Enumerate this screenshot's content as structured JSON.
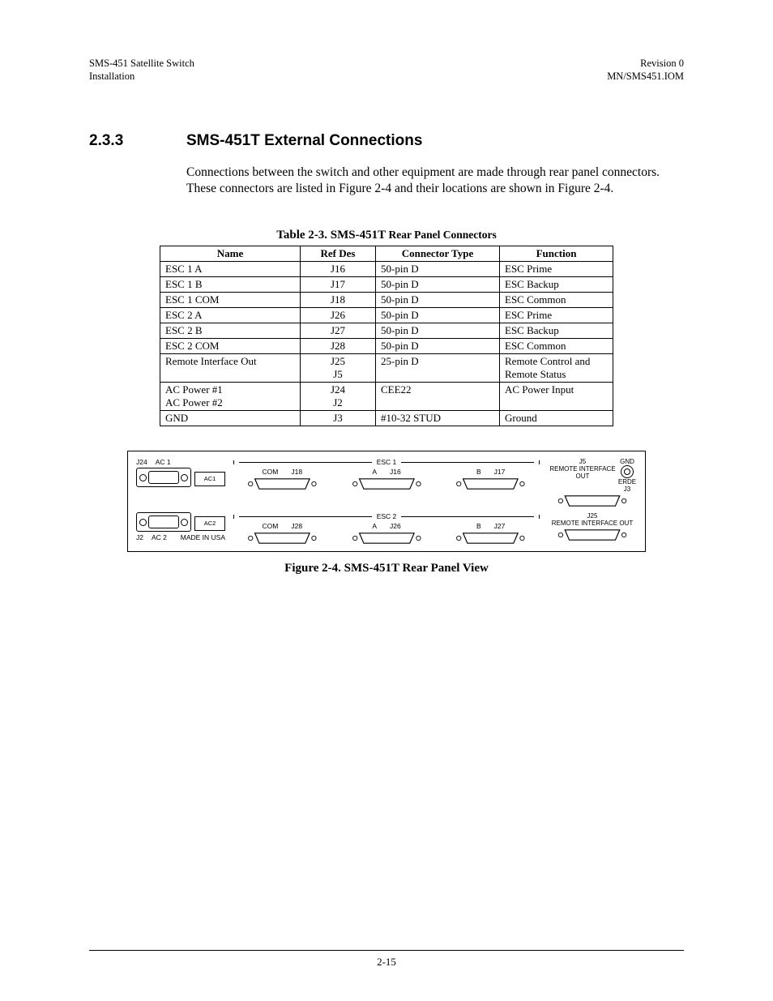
{
  "header": {
    "left_line1": "SMS-451 Satellite Switch",
    "left_line2": "Installation",
    "right_line1": "Revision 0",
    "right_line2": "MN/SMS451.IOM"
  },
  "section": {
    "number": "2.3.3",
    "title": "SMS-451T External Connections"
  },
  "paragraph": "Connections between the switch and other equipment are made through rear panel connectors. These connectors are listed in Figure 2-4 and their locations are shown in Figure 2-4.",
  "table": {
    "caption_prefix": "Table 2-3.  SMS-451T",
    "caption_suffix": " Rear Panel Connectors",
    "headers": [
      "Name",
      "Ref Des",
      "Connector Type",
      "Function"
    ],
    "rows": [
      {
        "name": "ESC 1 A",
        "ref": "J16",
        "type": "50-pin D",
        "func": "ESC Prime"
      },
      {
        "name": "ESC 1 B",
        "ref": "J17",
        "type": "50-pin D",
        "func": "ESC Backup"
      },
      {
        "name": "ESC 1 COM",
        "ref": "J18",
        "type": "50-pin D",
        "func": "ESC Common"
      },
      {
        "name": "ESC 2 A",
        "ref": "J26",
        "type": "50-pin D",
        "func": "ESC Prime"
      },
      {
        "name": "ESC 2 B",
        "ref": "J27",
        "type": "50-pin D",
        "func": "ESC Backup"
      },
      {
        "name": "ESC 2 COM",
        "ref": "J28",
        "type": "50-pin D",
        "func": "ESC Common"
      },
      {
        "name": "Remote Interface Out",
        "ref": "J25\nJ5",
        "type": "25-pin D",
        "func": "Remote Control and Remote Status"
      },
      {
        "name": "AC Power #1\nAC Power #2",
        "ref": "J24\nJ2",
        "type": "CEE22",
        "func": "AC Power Input"
      },
      {
        "name": "GND",
        "ref": "J3",
        "type": "#10-32 STUD",
        "func": "Ground"
      }
    ]
  },
  "figure": {
    "labels": {
      "j24": "J24",
      "ac1_top": "AC 1",
      "ac1_box": "AC1",
      "j2": "J2",
      "ac2_bot": "AC 2",
      "ac2_box": "AC2",
      "esc1": "ESC 1",
      "esc2": "ESC 2",
      "com": "COM",
      "a": "A",
      "b": "B",
      "j18": "J18",
      "j16": "J16",
      "j17": "J17",
      "j28": "J28",
      "j26": "J26",
      "j27": "J27",
      "j5": "J5",
      "j25": "J25",
      "remote": "REMOTE INTERFACE OUT",
      "gnd": "GND",
      "erde": "ERDE",
      "j3": "J3",
      "made": "MADE IN USA"
    },
    "caption": "Figure 2-4.  SMS-451T Rear Panel View"
  },
  "footer": {
    "page": "2-15"
  }
}
